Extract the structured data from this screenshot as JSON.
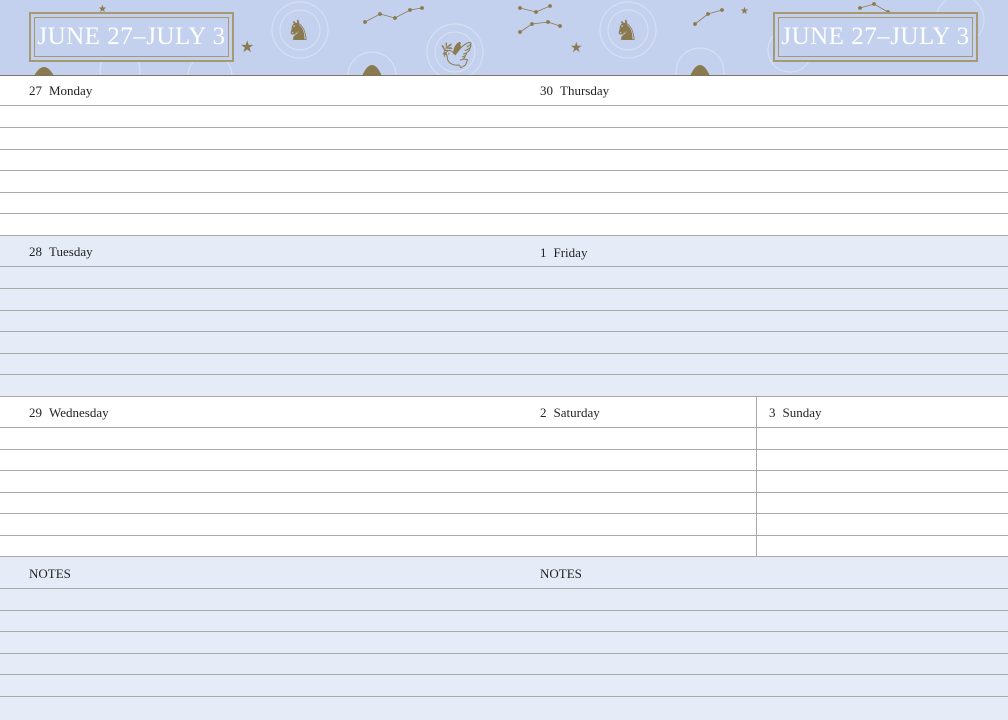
{
  "header": {
    "title_left": "JUNE 27–JULY 3",
    "title_right": "JUNE 27–JULY 3",
    "background_color": "#c3d1ee",
    "ornament_color": "#8b7a4f"
  },
  "days": {
    "monday": {
      "num": "27",
      "name": "Monday"
    },
    "thursday": {
      "num": "30",
      "name": "Thursday"
    },
    "tuesday": {
      "num": "28",
      "name": "Tuesday"
    },
    "friday": {
      "num": "1",
      "name": "Friday"
    },
    "wednesday": {
      "num": "29",
      "name": "Wednesday"
    },
    "saturday": {
      "num": "2",
      "name": "Saturday"
    },
    "sunday": {
      "num": "3",
      "name": "Sunday"
    }
  },
  "notes": {
    "left": "NOTES",
    "right": "NOTES"
  },
  "colors": {
    "row_blue": "#e5ecf8",
    "rule": "#a9a9a9"
  }
}
